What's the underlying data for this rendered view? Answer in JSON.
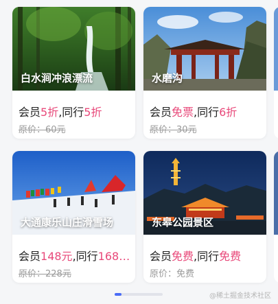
{
  "cards": [
    {
      "name": "白水涧冲浪漂流",
      "member_prefix": "会员",
      "member_value": "5折",
      "companion_prefix": ",同行",
      "companion_value": "5折",
      "original": "原价：60元",
      "original_struck": true
    },
    {
      "name": "水磨沟",
      "member_prefix": "会员",
      "member_value": "免票",
      "companion_prefix": ",同行",
      "companion_value": "6折",
      "original": "原价：30元",
      "original_struck": true
    },
    {
      "name": "大通康乐山庄滑雪场",
      "member_prefix": "会员",
      "member_value": "148元",
      "companion_prefix": ",同行",
      "companion_value": "168…",
      "original": "原价：228元",
      "original_struck": true
    },
    {
      "name": "东皋公园景区",
      "member_prefix": "会员",
      "member_value": "免费",
      "companion_prefix": ",同行",
      "companion_value": "免费",
      "original": "原价：免费",
      "original_struck": false
    }
  ],
  "pager": {
    "pages": 4,
    "active": 1
  },
  "watermark": "@稀土掘金技术社区",
  "colors": {
    "highlight": "#e8497a",
    "pager_active": "#4a6cf7",
    "background": "#f5f6f8"
  }
}
